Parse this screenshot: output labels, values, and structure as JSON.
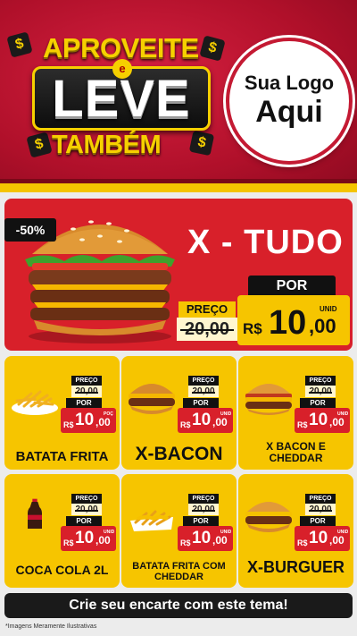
{
  "header": {
    "headline_top": "APROVEITE",
    "headline_connector": "e",
    "headline_main": "LEVE",
    "headline_bottom": "TAMBÉM",
    "dollar_symbol": "$",
    "logo_line1": "Sua Logo",
    "logo_line2": "Aqui"
  },
  "colors": {
    "header_red": "#c41a33",
    "accent_yellow": "#f6c500",
    "price_red": "#d8202a",
    "dark": "#111111"
  },
  "hero": {
    "discount": "-50%",
    "title": "X - TUDO",
    "preco_label": "PREÇO",
    "old_price": "20,00",
    "por_label": "POR",
    "currency": "R$",
    "price_int": "10",
    "price_dec": ",00",
    "unit": "UNID"
  },
  "products": [
    {
      "name": "BATATA FRITA",
      "icon": "fries-icon",
      "preco_label": "PREÇO",
      "old_price": "20,00",
      "por_label": "POR",
      "currency": "R$",
      "price_int": "10",
      "price_dec": ",00",
      "unit": "POÇ"
    },
    {
      "name": "X-BACON",
      "icon": "burger-icon",
      "preco_label": "PREÇO",
      "old_price": "20,00",
      "por_label": "POR",
      "currency": "R$",
      "price_int": "10",
      "price_dec": ",00",
      "unit": "UNID"
    },
    {
      "name": "X BACON E CHEDDAR",
      "icon": "burger-icon",
      "preco_label": "PREÇO",
      "old_price": "20,00",
      "por_label": "POR",
      "currency": "R$",
      "price_int": "10",
      "price_dec": ",00",
      "unit": "UNID"
    },
    {
      "name": "COCA COLA 2L",
      "icon": "soda-bottle-icon",
      "preco_label": "PREÇO",
      "old_price": "20,00",
      "por_label": "POR",
      "currency": "R$",
      "price_int": "10",
      "price_dec": ",00",
      "unit": "UNID"
    },
    {
      "name": "BATATA FRITA COM CHEDDAR",
      "icon": "fries-cheddar-icon",
      "preco_label": "PREÇO",
      "old_price": "20,00",
      "por_label": "POR",
      "currency": "R$",
      "price_int": "10",
      "price_dec": ",00",
      "unit": "UNID"
    },
    {
      "name": "X-BURGUER",
      "icon": "burger-icon",
      "preco_label": "PREÇO",
      "old_price": "20,00",
      "por_label": "POR",
      "currency": "R$",
      "price_int": "10",
      "price_dec": ",00",
      "unit": "UNID"
    }
  ],
  "footer": {
    "cta": "Crie seu encarte com este tema!",
    "disclaimer": "*Imagens Meramente Ilustrativas"
  }
}
